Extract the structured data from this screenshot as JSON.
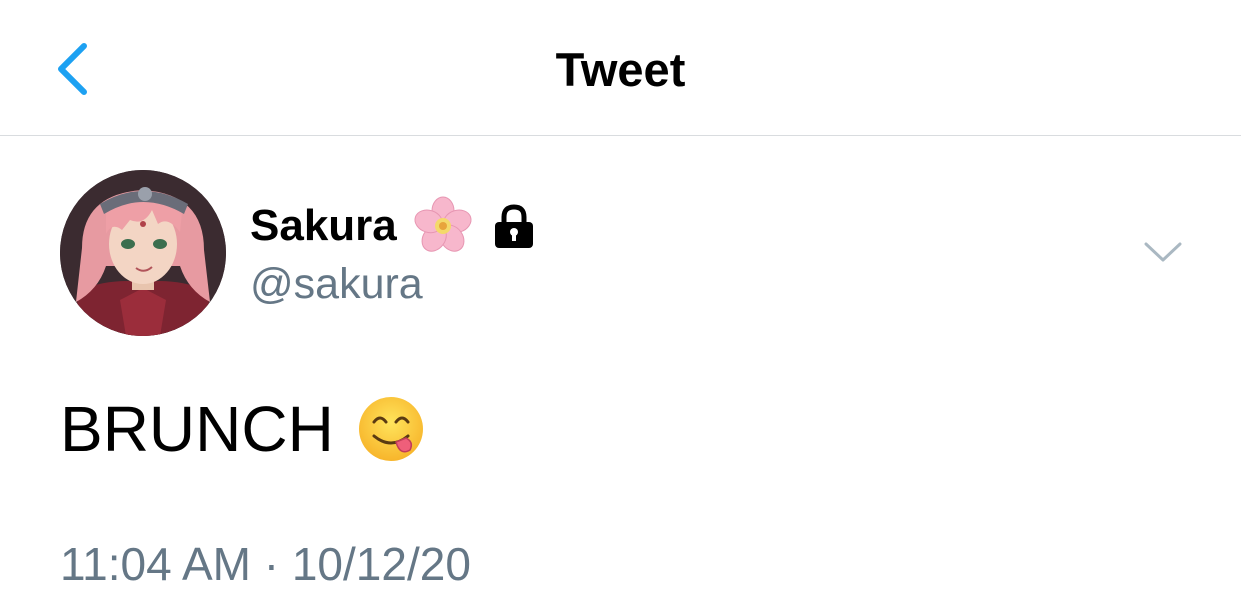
{
  "header": {
    "title": "Tweet",
    "back_icon": "chevron-left-icon",
    "accent": "#1da1f2"
  },
  "tweet": {
    "author": {
      "display_name": "Sakura",
      "handle": "@sakura",
      "name_emoji": "cherry-blossom-icon",
      "protected_icon": "lock-icon",
      "avatar": "avatar"
    },
    "text": "BRUNCH",
    "text_emoji": "face-savoring-food-icon",
    "menu_icon": "chevron-down-icon",
    "time": "11:04 AM",
    "separator": "·",
    "date": "10/12/20"
  },
  "colors": {
    "text_primary": "#000000",
    "text_secondary": "#657786",
    "divider": "#d9dcdf"
  }
}
